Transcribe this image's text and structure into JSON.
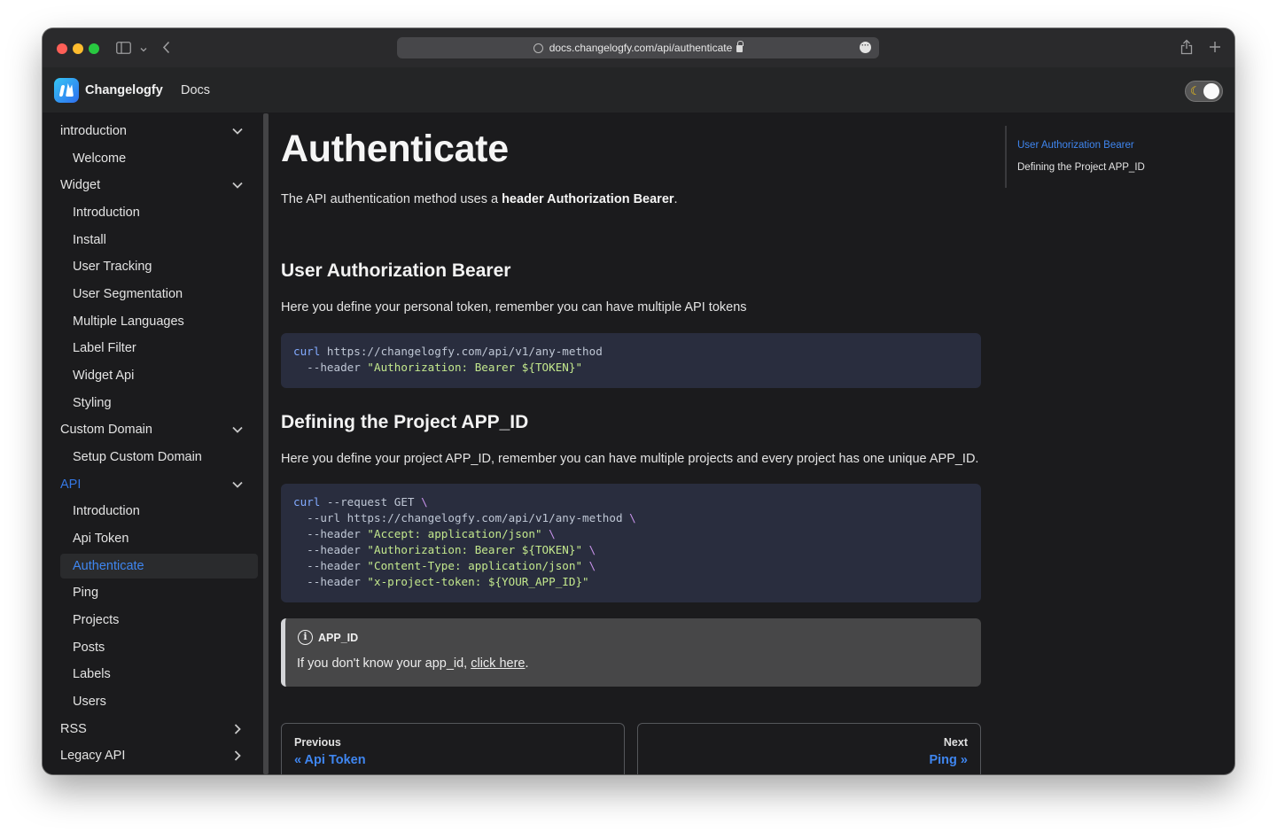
{
  "browser": {
    "url": "docs.changelogfy.com/api/authenticate"
  },
  "header": {
    "brand": "Changelogfy",
    "nav_docs": "Docs",
    "theme_icon": "☾"
  },
  "sidebar": {
    "categories": [
      {
        "label": "introduction",
        "expanded": true,
        "items": [
          "Welcome"
        ]
      },
      {
        "label": "Widget",
        "expanded": true,
        "items": [
          "Introduction",
          "Install",
          "User Tracking",
          "User Segmentation",
          "Multiple Languages",
          "Label Filter",
          "Widget Api",
          "Styling"
        ]
      },
      {
        "label": "Custom Domain",
        "expanded": true,
        "items": [
          "Setup Custom Domain"
        ]
      },
      {
        "label": "API",
        "expanded": true,
        "active": true,
        "items": [
          "Introduction",
          "Api Token",
          "Authenticate",
          "Ping",
          "Projects",
          "Posts",
          "Labels",
          "Users"
        ]
      },
      {
        "label": "RSS",
        "expanded": false,
        "items": []
      },
      {
        "label": "Legacy API",
        "expanded": false,
        "items": []
      }
    ],
    "active_item": "Authenticate"
  },
  "content": {
    "title": "Authenticate",
    "intro_prefix": "The API authentication method uses a ",
    "intro_bold": "header Authorization Bearer",
    "intro_suffix": ".",
    "section1": {
      "heading": "User Authorization Bearer",
      "text": "Here you define your personal token, remember you can have multiple API tokens",
      "code": {
        "l1_kw": "curl",
        "l1_rest": " https://changelogfy.com/api/v1/any-method",
        "l2_pre": "  --header ",
        "l2_str": "\"Authorization: Bearer ${TOKEN}\""
      }
    },
    "section2": {
      "heading": "Defining the Project APP_ID",
      "text": "Here you define your project APP_ID, remember you can have multiple projects and every project has one unique APP_ID.",
      "code": {
        "l1_kw": "curl",
        "l1_rest": " --request GET ",
        "l2_pre": "  --url https://changelogfy.com/api/v1/any-method ",
        "l3_pre": "  --header ",
        "l3_str": "\"Accept: application/json\"",
        "l4_pre": "  --header ",
        "l4_str": "\"Authorization: Bearer ${TOKEN}\"",
        "l5_pre": "  --header ",
        "l5_str": "\"Content-Type: application/json\"",
        "l6_pre": "  --header ",
        "l6_str": "\"x-project-token: ${YOUR_APP_ID}\"",
        "backslash": "\\"
      }
    },
    "admonition": {
      "icon": "info-icon",
      "title": "APP_ID",
      "text_prefix": "If you don't know your app_id, ",
      "link": "click here",
      "text_suffix": "."
    },
    "pager": {
      "prev_sub": "Previous",
      "prev_label": "« Api Token",
      "next_sub": "Next",
      "next_label": "Ping »"
    }
  },
  "toc": {
    "items": [
      "User Authorization Bearer",
      "Defining the Project APP_ID"
    ],
    "active": "User Authorization Bearer"
  },
  "colors": {
    "accent": "#3f86f0",
    "background": "#1b1b1d",
    "code_bg": "#292d3e"
  }
}
